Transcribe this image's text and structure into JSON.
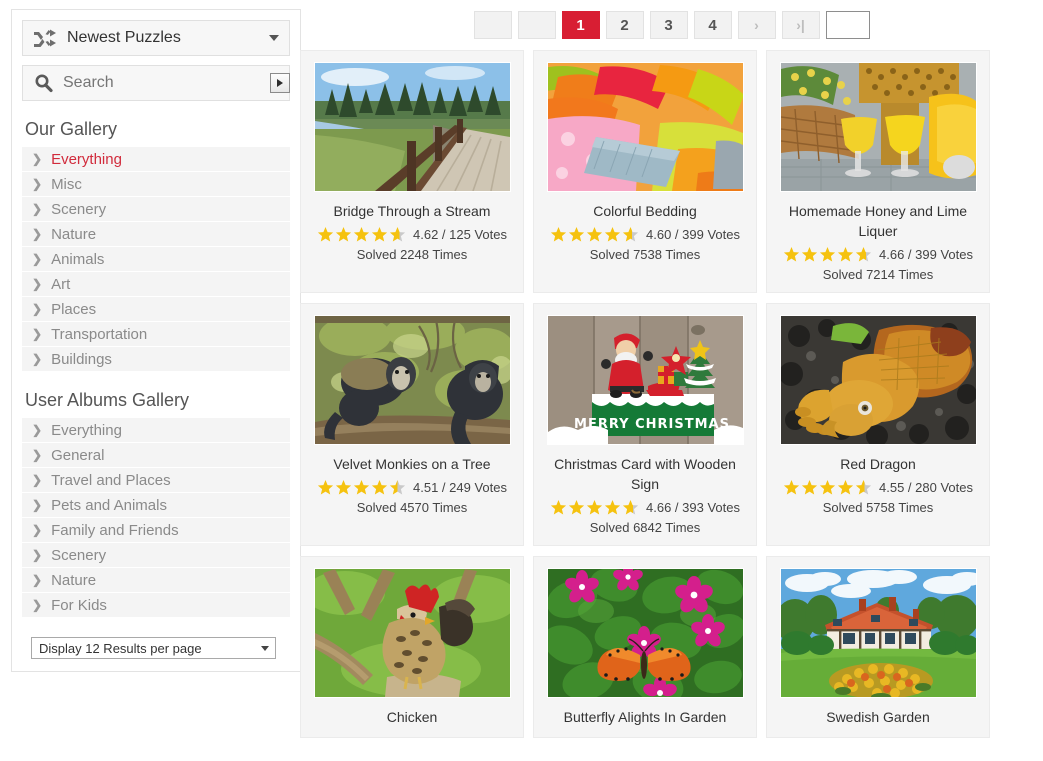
{
  "sidebar": {
    "sort_select": {
      "icon": "shuffle-icon",
      "label": "Newest Puzzles",
      "caret": "▼"
    },
    "search": {
      "icon": "search-icon",
      "value": "",
      "placeholder": "Search",
      "submit_icon": "play-right-icon"
    },
    "our_gallery": {
      "heading": "Our Gallery",
      "items": [
        {
          "label": "Everything",
          "active": true
        },
        {
          "label": "Misc",
          "active": false
        },
        {
          "label": "Scenery",
          "active": false
        },
        {
          "label": "Nature",
          "active": false
        },
        {
          "label": "Animals",
          "active": false
        },
        {
          "label": "Art",
          "active": false
        },
        {
          "label": "Places",
          "active": false
        },
        {
          "label": "Transportation",
          "active": false
        },
        {
          "label": "Buildings",
          "active": false
        }
      ]
    },
    "user_albums": {
      "heading": "User Albums Gallery",
      "items": [
        {
          "label": "Everything",
          "active": false
        },
        {
          "label": "General",
          "active": false
        },
        {
          "label": "Travel and Places",
          "active": false
        },
        {
          "label": "Pets and Animals",
          "active": false
        },
        {
          "label": "Family and Friends",
          "active": false
        },
        {
          "label": "Scenery",
          "active": false
        },
        {
          "label": "Nature",
          "active": false
        },
        {
          "label": "For Kids",
          "active": false
        }
      ]
    },
    "results_per_page": {
      "label": "Display 12 Results per page",
      "caret": "▼"
    }
  },
  "pager": {
    "buttons": [
      {
        "label": "",
        "kind": "blank",
        "name": "first-page-button"
      },
      {
        "label": "",
        "kind": "blank",
        "name": "prev-page-button"
      },
      {
        "label": "1",
        "kind": "active",
        "name": "page-1-button"
      },
      {
        "label": "2",
        "kind": "page",
        "name": "page-2-button"
      },
      {
        "label": "3",
        "kind": "page",
        "name": "page-3-button"
      },
      {
        "label": "4",
        "kind": "page",
        "name": "page-4-button"
      },
      {
        "label": "›",
        "kind": "arrow",
        "name": "next-page-button"
      },
      {
        "label": "›|",
        "kind": "arrow",
        "name": "last-page-button"
      }
    ],
    "jump_input": {
      "value": "",
      "placeholder": ""
    }
  },
  "accent_color": "#d81e33",
  "star_color": "#f5c20f",
  "star_empty_color": "#c9c9c9",
  "cards": [
    {
      "title": "Bridge Through a Stream",
      "rating": "4.62 / 125 Votes",
      "stars": 4.62,
      "solved": "Solved 2248 Times",
      "thumb": "bridge-through-a-stream-thumbnail"
    },
    {
      "title": "Colorful Bedding",
      "rating": "4.60 / 399 Votes",
      "stars": 4.6,
      "solved": "Solved 7538 Times",
      "thumb": "colorful-bedding-thumbnail"
    },
    {
      "title": "Homemade Honey and Lime Liquer",
      "rating": "4.66 / 399 Votes",
      "stars": 4.66,
      "solved": "Solved 7214 Times",
      "thumb": "homemade-honey-and-lime-liquer-thumbnail"
    },
    {
      "title": "Velvet Monkies on a Tree",
      "rating": "4.51 / 249 Votes",
      "stars": 4.51,
      "solved": "Solved 4570 Times",
      "thumb": "velvet-monkies-on-a-tree-thumbnail"
    },
    {
      "title": "Christmas Card with Wooden Sign",
      "rating": "4.66 / 393 Votes",
      "stars": 4.66,
      "solved": "Solved 6842 Times",
      "thumb": "christmas-card-with-wooden-sign-thumbnail"
    },
    {
      "title": "Red Dragon",
      "rating": "4.55 / 280 Votes",
      "stars": 4.55,
      "solved": "Solved 5758 Times",
      "thumb": "red-dragon-thumbnail"
    },
    {
      "title": "Chicken",
      "rating": "",
      "stars": 0,
      "solved": "",
      "thumb": "chicken-thumbnail"
    },
    {
      "title": "Butterfly Alights In Garden",
      "rating": "",
      "stars": 0,
      "solved": "",
      "thumb": "butterfly-alights-in-garden-thumbnail"
    },
    {
      "title": "Swedish Garden",
      "rating": "",
      "stars": 0,
      "solved": "",
      "thumb": "swedish-garden-thumbnail"
    }
  ]
}
